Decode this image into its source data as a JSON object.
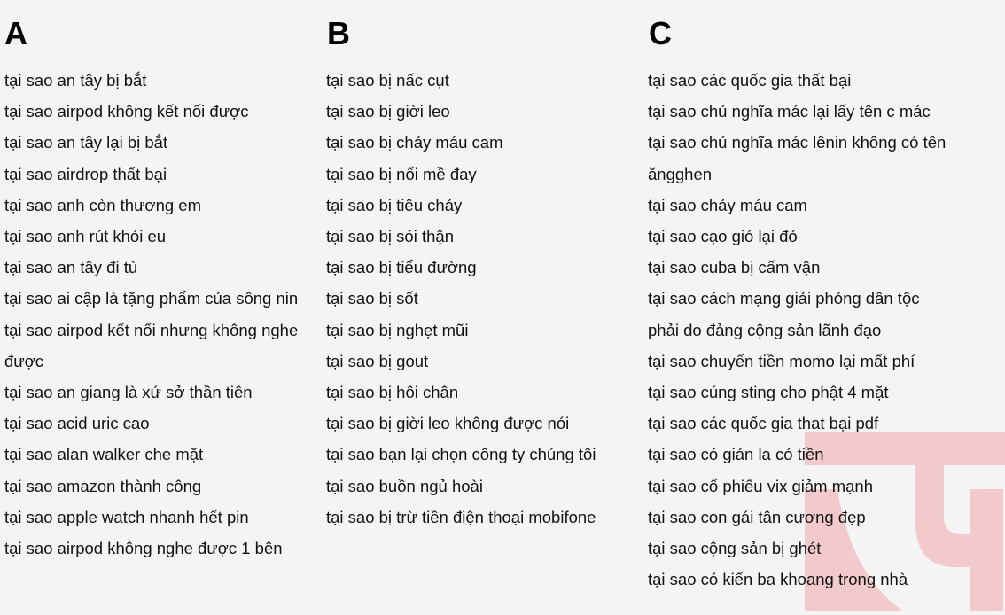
{
  "colors": {
    "background": "#f4f4f4",
    "text": "#111111",
    "heading": "#000000",
    "watermark": "#f2cacb"
  },
  "watermark": {
    "icon": "brand-logo-watermark-icon"
  },
  "columns": [
    {
      "letter": "A",
      "items": [
        "tại sao an tây bị bắt",
        "tại sao airpod không kết nối được",
        "tại sao an tây lại bị bắt",
        "tại sao airdrop thất bại",
        "tại sao anh còn thương em",
        "tại sao anh rút khỏi eu",
        "tại sao an tây đi tù",
        "tại sao ai cập là tặng phẩm của sông nin",
        "tại sao airpod kết nối nhưng không nghe được",
        "tại sao an giang là xứ sở thần tiên",
        "tại sao acid uric cao",
        "tại sao alan walker che mặt",
        "tại sao amazon thành công",
        "tại sao apple watch nhanh hết pin",
        "tại sao airpod không nghe được 1 bên"
      ]
    },
    {
      "letter": "B",
      "items": [
        "tại sao bị nấc cụt",
        "tại sao bị giời leo",
        "tại sao bị chảy máu cam",
        "tại sao bị nổi mề đay",
        "tại sao bị tiêu chảy",
        "tại sao bị sỏi thận",
        "tại sao bị tiểu đường",
        "tại sao bị sốt",
        "tại sao bị nghẹt mũi",
        "tại sao bị gout",
        "tại sao bị hôi chân",
        "tại sao bị giời leo không được nói",
        "tại sao bạn lại chọn công ty chúng tôi",
        "tại sao buồn ngủ hoài",
        "tại sao bị trừ tiền điện thoại mobifone"
      ]
    },
    {
      "letter": "C",
      "items": [
        "tại sao các quốc gia thất bại",
        "tại sao chủ nghĩa mác lại lấy tên c mác",
        "tại sao chủ nghĩa mác lênin không có tên ăngghen",
        "tại sao chảy máu cam",
        "tại sao cạo gió lại đỏ",
        "tại sao cuba bị cấm vận",
        "tại sao cách mạng giải phóng dân tộc phải do đảng cộng sản lãnh đạo",
        "tại sao chuyển tiền momo lại mất phí",
        "tại sao cúng sting cho phật 4 mặt",
        "tại sao các quốc gia that bại pdf",
        "tại sao có gián la có tiền",
        "tại sao cổ phiếu vix giảm mạnh",
        "tại sao con gái tân cương đẹp",
        "tại sao cộng sản bị ghét",
        "tại sao có kiến ba khoang trong nhà"
      ]
    }
  ]
}
